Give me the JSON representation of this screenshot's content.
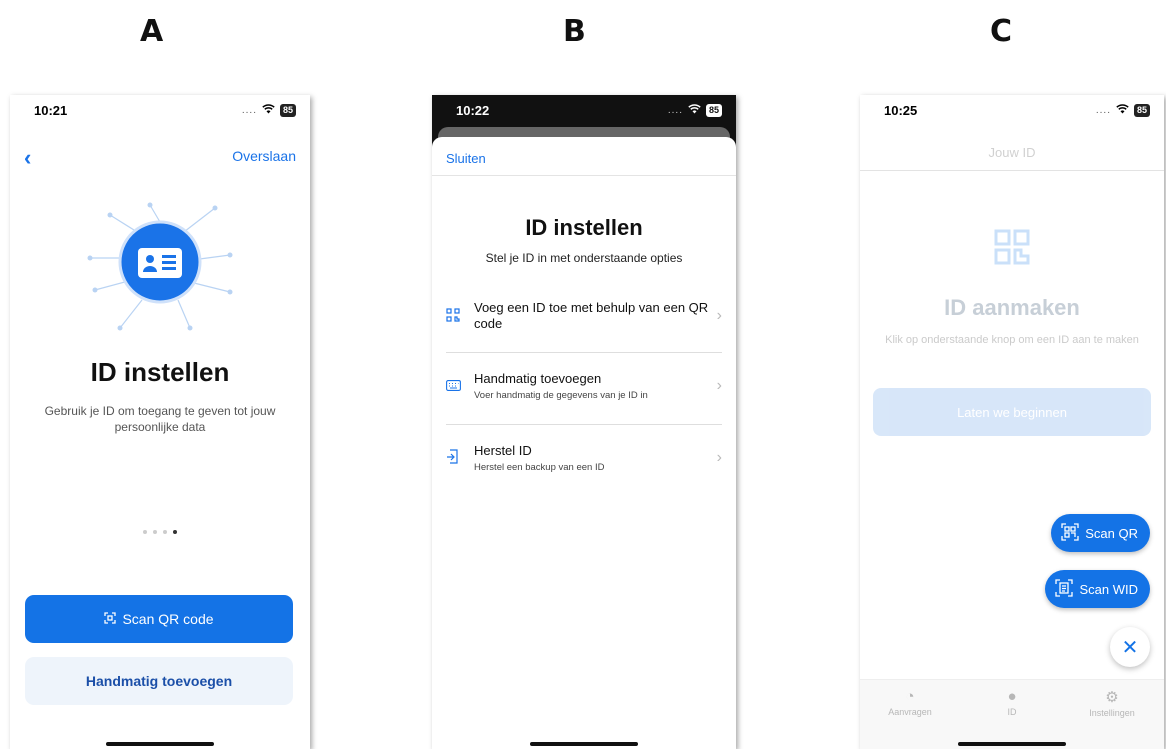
{
  "labels": {
    "a": "A",
    "b": "B",
    "c": "C"
  },
  "phoneA": {
    "time": "10:21",
    "battery": "85",
    "skip": "Overslaan",
    "title": "ID instellen",
    "description": "Gebruik je ID om toegang te geven tot jouw persoonlijke data",
    "pager": {
      "count": 4,
      "active": 4
    },
    "primary_button": "Scan QR code",
    "secondary_button": "Handmatig toevoegen"
  },
  "phoneB": {
    "time": "10:22",
    "battery": "85",
    "close": "Sluiten",
    "title": "ID instellen",
    "subtitle": "Stel je ID in met onderstaande opties",
    "options": [
      {
        "title": "Voeg een ID toe met behulp van een QR code",
        "subtitle": "",
        "icon": "qr-icon"
      },
      {
        "title": "Handmatig toevoegen",
        "subtitle": "Voer handmatig de gegevens van je ID in",
        "icon": "keyboard-icon"
      },
      {
        "title": "Herstel ID",
        "subtitle": "Herstel een backup van een ID",
        "icon": "restore-icon"
      }
    ]
  },
  "phoneC": {
    "time": "10:25",
    "battery": "85",
    "header": "Jouw ID",
    "title": "ID aanmaken",
    "description": "Klik op onderstaande knop om een ID aan te maken",
    "button": "Laten we beginnen",
    "fab_scan_qr": "Scan QR",
    "fab_scan_wid": "Scan WID",
    "tabs": [
      {
        "label": "Aanvragen",
        "icon": "requests-icon"
      },
      {
        "label": "ID",
        "icon": "person-icon"
      },
      {
        "label": "Instellingen",
        "icon": "gear-icon"
      }
    ]
  }
}
